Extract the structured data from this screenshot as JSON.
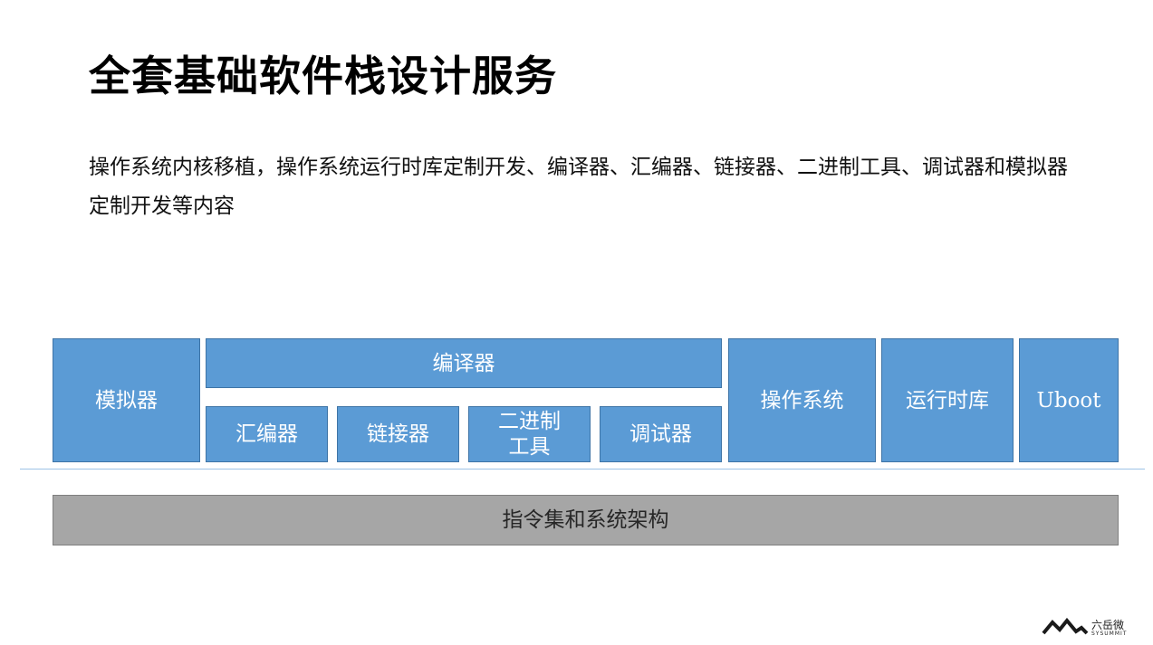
{
  "slide": {
    "title": "全套基础软件栈设计服务",
    "description": "操作系统内核移植，操作系统运行时库定制开发、编译器、汇编器、链接器、二进制工具、调试器和模拟器定制开发等内容"
  },
  "diagram": {
    "simulator": "模拟器",
    "compiler": "编译器",
    "assembler": "汇编器",
    "linker": "链接器",
    "binary_tools": "二进制\n工具",
    "debugger": "调试器",
    "operating_system": "操作系统",
    "runtime_library": "运行时库",
    "uboot": "Uboot",
    "isa_base": "指令集和系统架构"
  },
  "logo": {
    "name_cn": "六岳微",
    "name_en": "SYSUMMIT"
  },
  "colors": {
    "box_blue": "#5b9bd5",
    "base_gray": "#a6a6a6",
    "divider": "#9dc3e6"
  }
}
